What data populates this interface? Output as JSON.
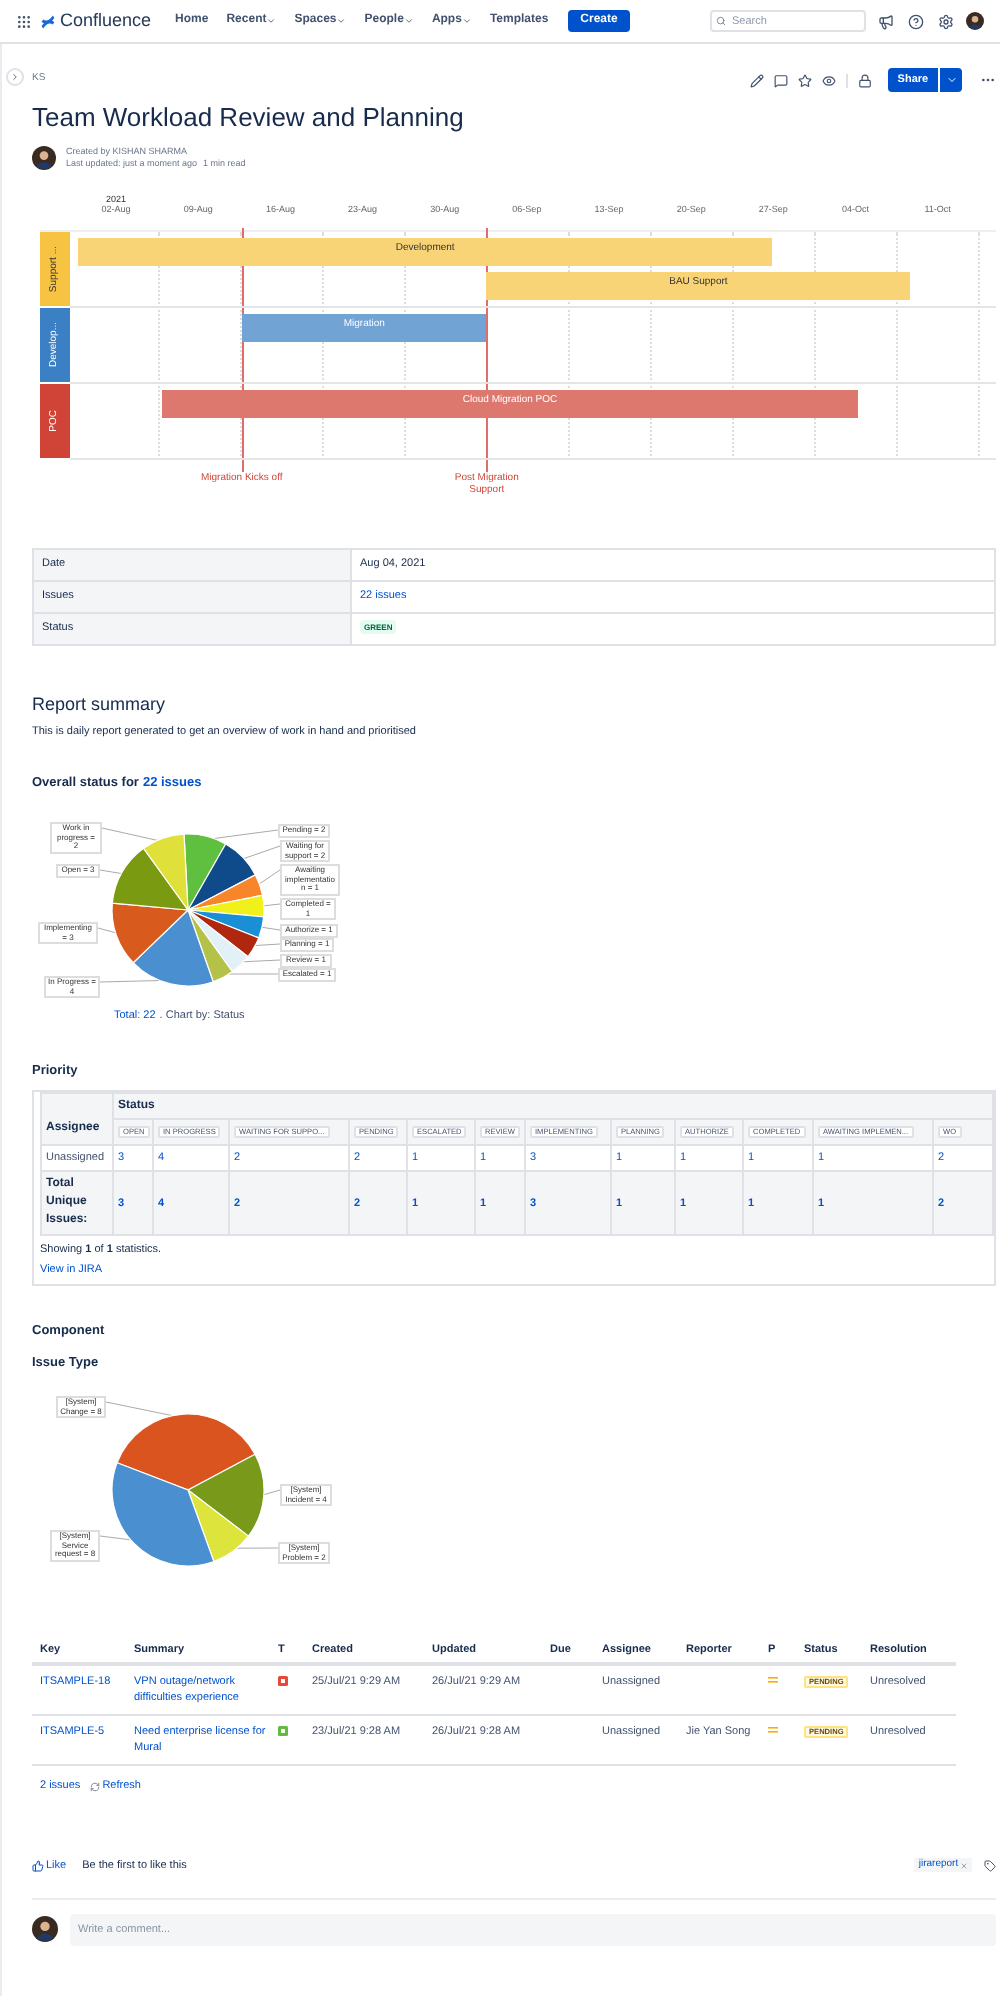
{
  "nav": {
    "logo": "Confluence",
    "items": [
      {
        "label": "Home",
        "dropdown": false
      },
      {
        "label": "Recent",
        "dropdown": true
      },
      {
        "label": "Spaces",
        "dropdown": true
      },
      {
        "label": "People",
        "dropdown": true
      },
      {
        "label": "Apps",
        "dropdown": true
      },
      {
        "label": "Templates",
        "dropdown": false
      }
    ],
    "create": "Create",
    "search": {
      "placeholder": "Search"
    }
  },
  "breadcrumb": "KS",
  "actions": {
    "share": "Share"
  },
  "page": {
    "title": "Team Workload Review and Planning",
    "created_by": "Created by KISHAN SHARMA",
    "last_updated": "Last updated: just a moment ago",
    "read_time": "1 min read"
  },
  "timeline": {
    "year": "2021",
    "ticks": [
      "02-Aug",
      "09-Aug",
      "16-Aug",
      "23-Aug",
      "30-Aug",
      "06-Sep",
      "13-Sep",
      "20-Sep",
      "27-Sep",
      "04-Oct",
      "11-Oct"
    ],
    "lanes": [
      {
        "label": "Support ...",
        "color": "#f6c342",
        "bars": [
          {
            "label": "Development"
          },
          {
            "label": "BAU Support"
          }
        ]
      },
      {
        "label": "Develop...",
        "color": "#3b7fc4",
        "bars": [
          {
            "label": "Migration"
          }
        ]
      },
      {
        "label": "POC",
        "color": "#d04437",
        "bars": [
          {
            "label": "Cloud Migration POC"
          }
        ]
      }
    ],
    "milestones": [
      {
        "label": "Migration Kicks off"
      },
      {
        "label": "Post Migration Support"
      }
    ]
  },
  "info_table": [
    {
      "label": "Date",
      "value": "Aug 04, 2021",
      "kind": "text"
    },
    {
      "label": "Issues",
      "value": "22 issues",
      "kind": "link"
    },
    {
      "label": "Status",
      "value": "GREEN",
      "kind": "lozenge"
    }
  ],
  "report": {
    "heading": "Report summary",
    "description": "This is daily report generated to get an overview of work in hand and prioritised",
    "status_heading": "Overall status for",
    "status_link": "22 issues",
    "chart_data": {
      "type": "pie",
      "values": [
        2,
        2,
        1,
        1,
        1,
        1,
        1,
        1,
        4,
        3,
        3,
        2
      ],
      "colors": [
        "#5fbf3f",
        "#0f4a8a",
        "#f7862a",
        "#f0f01a",
        "#1a8fd6",
        "#b0270f",
        "#e2f0f8",
        "#b5c24a",
        "#4a90d0",
        "#d85a1d",
        "#7a9a12",
        "#e0e03a"
      ],
      "value_labels": [
        "Pending = 2",
        "Waiting for support = 2",
        "Awaiting implementatio n = 1",
        "Completed = 1",
        "Authorize = 1",
        "Planning = 1",
        "Review = 1",
        "Escalated = 1",
        "In Progress = 4",
        "Implementing = 3",
        "Open = 3",
        "Work in progress = 2"
      ]
    },
    "caption_link": "Total: 22",
    "caption_text": ". Chart by: Status"
  },
  "priority": {
    "heading": "Priority",
    "row_header": "Assignee",
    "group_header": "Status",
    "columns": [
      "OPEN",
      "IN PROGRESS",
      "WAITING FOR SUPPO...",
      "PENDING",
      "ESCALATED",
      "REVIEW",
      "IMPLEMENTING",
      "PLANNING",
      "AUTHORIZE",
      "COMPLETED",
      "AWAITING IMPLEMEN...",
      "WO"
    ],
    "rows": [
      {
        "label": "Unassigned",
        "total": false,
        "values": [
          "3",
          "4",
          "2",
          "2",
          "1",
          "1",
          "3",
          "1",
          "1",
          "1",
          "1",
          "2"
        ]
      },
      {
        "label": "Total Unique Issues:",
        "total": true,
        "values": [
          "3",
          "4",
          "2",
          "2",
          "1",
          "1",
          "3",
          "1",
          "1",
          "1",
          "1",
          "2"
        ]
      }
    ],
    "showing": "Showing **1** of **1** statistics.",
    "link": "View in JIRA"
  },
  "component": {
    "heading": "Component",
    "issue_type_heading": "Issue Type",
    "chart_data": {
      "type": "pie",
      "values": [
        8,
        4,
        2,
        8
      ],
      "colors": [
        "#d9541e",
        "#78991a",
        "#dde43c",
        "#4a8fd0"
      ],
      "value_labels": [
        "[System] Change = 8",
        "[System] Incident = 4",
        "[System] Problem = 2",
        "[System] Service request = 8"
      ]
    }
  },
  "issues": {
    "columns": [
      "Key",
      "Summary",
      "T",
      "Created",
      "Updated",
      "Due",
      "Assignee",
      "Reporter",
      "P",
      "Status",
      "Resolution"
    ],
    "rows": [
      {
        "key": "ITSAMPLE-18",
        "summary": "VPN outage/network difficulties experience",
        "kind": "incident",
        "created": "25/Jul/21 9:29 AM",
        "updated": "26/Jul/21 9:29 AM",
        "assignee": "Unassigned",
        "status": "PENDING",
        "resolution": "Unresolved"
      },
      {
        "key": "ITSAMPLE-5",
        "summary": "Need enterprise license for Mural",
        "kind": "service_request",
        "created": "23/Jul/21 9:28 AM",
        "updated": "26/Jul/21 9:28 AM",
        "assignee": "Unassigned",
        "reporter": "Jie Yan Song",
        "status": "PENDING",
        "resolution": "Unresolved"
      }
    ],
    "count": "2 issues",
    "refresh": "Refresh"
  },
  "likes": {
    "like": "Like",
    "text": "Be the first to like this",
    "label": "jirareport"
  },
  "comment": {
    "placeholder": "Write a comment..."
  }
}
